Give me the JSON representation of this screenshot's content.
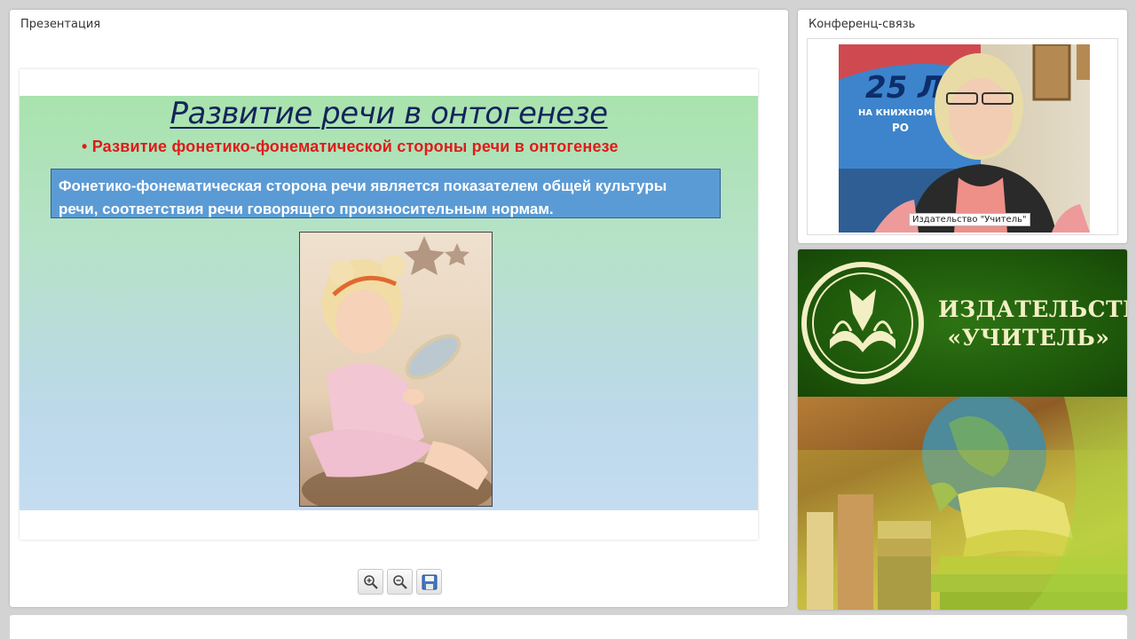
{
  "presentation": {
    "panel_title": "Презентация",
    "slide": {
      "title": "Развитие речи в онтогенезе",
      "subtitle": "• Развитие фонетико-фонематической стороны речи в онтогенезе",
      "box_line1": "Фонетико-фонематическая сторона речи является показателем общей культуры",
      "box_line2": "речи, соответствия речи говорящего произносительным нормам."
    },
    "toolbar": [
      {
        "icon": "zoom-in-icon"
      },
      {
        "icon": "zoom-out-icon"
      },
      {
        "icon": "save-icon"
      }
    ]
  },
  "conference": {
    "panel_title": "Конференц-связь",
    "video_label": "Издательство \"Учитель\"",
    "banner_line1": "25 Л",
    "banner_line2": "НА КНИЖНОМ",
    "banner_line3": "РО"
  },
  "publisher": {
    "name_line1": "ИЗДАТЕЛЬСТВО",
    "name_line2": "«УЧИТЕЛЬ»"
  },
  "colors": {
    "slide_title": "#14245a",
    "slide_subtitle": "#e01b1b",
    "slide_box": "#5b9bd5",
    "publisher_green": "#1d560a"
  }
}
